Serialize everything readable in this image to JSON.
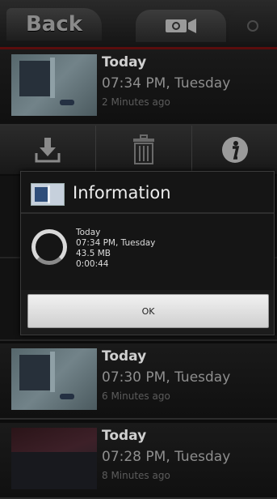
{
  "header": {
    "back_label": "Back",
    "tab_video_icon": "video-camera-icon",
    "tab_other_icon": "audio-icon"
  },
  "recordings": [
    {
      "title": "Today",
      "time": "07:34 PM, Tuesday",
      "ago": "2 Minutes ago"
    },
    {
      "title": "Today",
      "time": "07:30 PM, Tuesday",
      "ago": "6 Minutes ago"
    },
    {
      "title": "Today",
      "time": "07:28 PM, Tuesday",
      "ago": "8 Minutes ago"
    }
  ],
  "actions": {
    "download_icon": "download-icon",
    "delete_icon": "trash-icon",
    "info_icon": "info-icon"
  },
  "dialog": {
    "title": "Information",
    "details": {
      "day": "Today",
      "time": "07:34 PM, Tuesday",
      "size": "43.5 MB",
      "duration": "0:00:44"
    },
    "ok_label": "OK"
  }
}
